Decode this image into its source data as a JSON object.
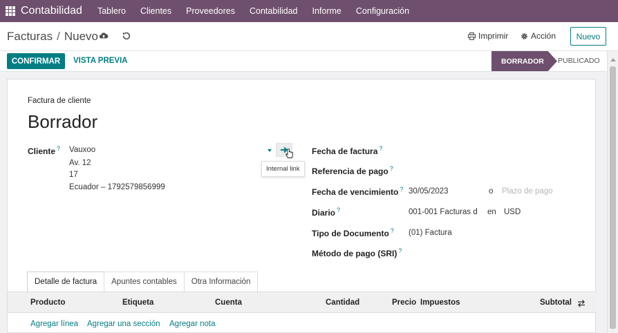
{
  "navbar": {
    "brand": "Contabilidad",
    "items": [
      "Tablero",
      "Clientes",
      "Proveedores",
      "Contabilidad",
      "Informe",
      "Configuración"
    ]
  },
  "control": {
    "breadcrumb_parent": "Facturas",
    "breadcrumb_current": "Nuevo",
    "print_label": "Imprimir",
    "action_label": "Acción",
    "new_label": "Nuevo"
  },
  "statusbar": {
    "confirm_label": "CONFIRMAR",
    "preview_label": "VISTA PREVIA",
    "stages": [
      "BORRADOR",
      "PUBLICADO"
    ]
  },
  "form": {
    "doc_type": "Factura de cliente",
    "title": "Borrador",
    "customer_label": "Cliente",
    "customer_lines": [
      "Vauxoo",
      "Av. 12",
      "17",
      "Ecuador – 1792579856999"
    ],
    "tooltip": "Internal link",
    "invoice_date_label": "Fecha de factura",
    "payment_ref_label": "Referencia de pago",
    "due_date_label": "Fecha de vencimiento",
    "due_date_value": "30/05/2023",
    "or_label": "o",
    "payment_terms_placeholder": "Plazo de pago",
    "journal_label": "Diario",
    "journal_value": "001-001 Facturas d",
    "in_label": "en",
    "currency_value": "USD",
    "doc_kind_label": "Tipo de Documento",
    "doc_kind_value": "(01) Factura",
    "payment_method_label": "Método de pago (SRI)",
    "help_mark": "?"
  },
  "tabs": [
    "Detalle de factura",
    "Apuntes contables",
    "Otra Información"
  ],
  "table": {
    "columns": [
      "Producto",
      "Etiqueta",
      "Cuenta",
      "Cantidad",
      "Precio",
      "Impuestos",
      "Subtotal"
    ],
    "add_links": [
      "Agregar línea",
      "Agregar una sección",
      "Agregar nota"
    ]
  },
  "colors": {
    "navbar": "#6e4f6d",
    "primary": "#017e84",
    "stage_active": "#6e4f6d"
  }
}
